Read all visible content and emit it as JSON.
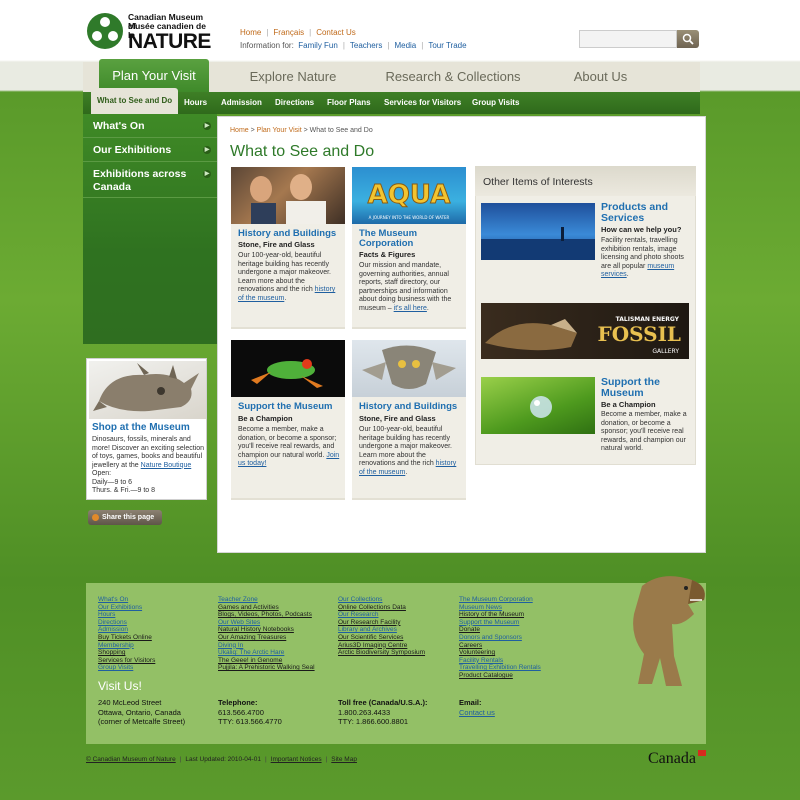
{
  "header": {
    "logo_line1": "Canadian Museum of",
    "logo_line2": "Musée canadien de la",
    "logo_line3": "NATURE",
    "top_links": [
      "Home",
      "Français",
      "Contact Us"
    ],
    "info_label": "Information for:",
    "info_links": [
      "Family Fun",
      "Teachers",
      "Media",
      "Tour Trade"
    ],
    "search_placeholder": ""
  },
  "main_nav": [
    "Plan Your Visit",
    "Explore Nature",
    "Research & Collections",
    "About Us"
  ],
  "sub_nav": [
    "What to See and Do",
    "Hours",
    "Admission",
    "Directions",
    "Floor Plans",
    "Services for Visitors",
    "Group Visits"
  ],
  "side_nav": [
    "What's On",
    "Our Exhibitions",
    "Exhibitions across Canada"
  ],
  "shop": {
    "title": "Shop at the Museum",
    "text1": "Dinosaurs, fossils, minerals and more! Discover an exciting selection of toys, games, books and beautiful jewellery at the",
    "link": "Nature Boutique",
    "hours_label": "Open:",
    "hours1": "Daily—9 to 6",
    "hours2": "Thurs. & Fri.—9 to 8"
  },
  "share_label": "Share this page",
  "breadcrumb": {
    "home": "Home",
    "sep": " > ",
    "parent": "Plan Your Visit",
    "current": "What to See and Do"
  },
  "page_title": "What to See and Do",
  "cards": [
    {
      "title": "History and Buildings",
      "subtitle": "Stone, Fire and Glass",
      "text": "Our 100-year-old, beautiful heritage building has recently undergone a major makeover. Learn more about the renovations and the rich",
      "link": "history of the museum",
      "tail": "."
    },
    {
      "title": "The Museum Corporation",
      "subtitle": "Facts & Figures",
      "text": "Our mission and mandate, governing authorities, annual reports, staff directory, our partnerships and information about doing business with the museum –",
      "link": "it's all here",
      "tail": "."
    },
    {
      "title": "Support the Museum",
      "subtitle": "Be a Champion",
      "text": "Become a member, make a donation, or become a sponsor; you'll receive real rewards, and champion our natural world.",
      "link": "Join us today!",
      "tail": ""
    },
    {
      "title": "History and Buildings",
      "subtitle": "Stone, Fire and Glass",
      "text": "Our 100-year-old, beautiful heritage building has recently undergone a major makeover. Learn more about the renovations and the rich",
      "link": "history of the museum",
      "tail": "."
    }
  ],
  "aqua_banner": {
    "word": "AQUA",
    "tag": "A JOURNEY INTO THE WORLD OF WATER"
  },
  "others": {
    "heading": "Other Items of Interests",
    "products": {
      "title": "Products and Services",
      "subtitle": "How can we help you?",
      "text": "Facility rentals, travelling exhibition rentals, image licensing and photo shoots are all popular",
      "link": "museum services",
      "tail": "."
    },
    "fossil": {
      "top": "TALISMAN ENERGY",
      "word": "FOSSIL",
      "bottom": "GALLERY"
    },
    "support": {
      "title": "Support the Museum",
      "subtitle": "Be a Champion",
      "text": "Become a member, make a donation, or become a sponsor; you'll receive real rewards, and champion our natural world."
    }
  },
  "footer": {
    "col1": [
      "What's On",
      "Our Exhibitions",
      "Hours",
      "Directions",
      "Admission",
      "Buy Tickets Online",
      "Membership",
      "Shopping",
      "Services for Visitors",
      "Group Visits"
    ],
    "col2": [
      "Teacher Zone",
      "Games and Activities",
      "Blogs, Videos, Photos, Podcasts",
      "Our Web Sites",
      "Natural History Notebooks",
      "Our Amazing Treasures",
      "Diving In",
      "Ukaliq: The Arctic Hare",
      "The Geee! in Genome",
      "Pujjila: A Prehistoric Walking Seal"
    ],
    "col3": [
      "Our Collections",
      "Online Collections Data",
      "Our Research",
      "Our Research Facility",
      "Library and Archives",
      "Our Scientific Services",
      "Arius3D Imaging Centre",
      "Arctic Biodiversity Symposium"
    ],
    "col4": [
      "The Museum Corporation",
      "Museum News",
      "History of the Museum",
      "Support the Museum",
      "Donate",
      "Donors and Sponsors",
      "Careers",
      "Volunteering",
      "Facility Rentals",
      "Travelling Exhibition Rentals",
      "Product Catalogue"
    ],
    "visit_title": "Visit Us!",
    "address": [
      "240 McLeod Street",
      "Ottawa, Ontario, Canada",
      "(corner of Metcalfe Street)"
    ],
    "telephone": {
      "label": "Telephone:",
      "lines": [
        "613.566.4700",
        "TTY: 613.566.4770"
      ]
    },
    "tollfree": {
      "label": "Toll free (Canada/U.S.A.):",
      "lines": [
        "1.800.263.4433",
        "TTY: 1.866.600.8801"
      ]
    },
    "email": {
      "label": "Email:",
      "link": "Contact us"
    }
  },
  "bottom": {
    "copyright": "© Canadian Museum of Nature",
    "updated": "Last Updated: 2010-04-01",
    "notices": "Important Notices",
    "sitemap": "Site Map",
    "wordmark": "Canada"
  },
  "colors": {
    "green_nav": "#3f8a2a",
    "link_blue": "#1f6fb0",
    "orange_link": "#c06a1a",
    "footer_bg": "#93c066"
  }
}
